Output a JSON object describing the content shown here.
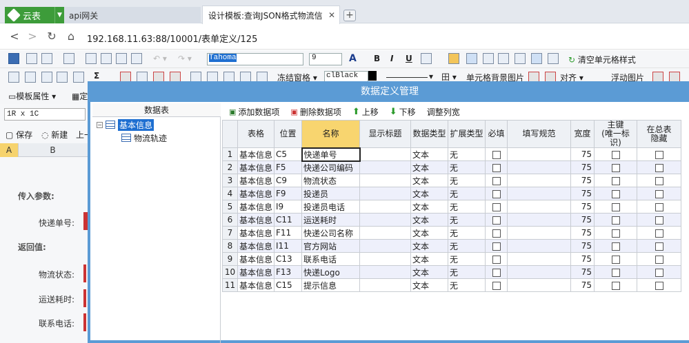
{
  "browser": {
    "brand": "云表",
    "tabs": [
      {
        "label": "api网关"
      },
      {
        "label": "设计模板:查询JSON格式物流信"
      }
    ],
    "url": "192.168.11.63:88/10001/表单定义/125"
  },
  "toolbar": {
    "font_name": "Tahoma",
    "font_size": "9",
    "clear_style": "清空单元格样式",
    "freeze": "冻结窗格",
    "color_value": "clBlack",
    "cell_bg_image": "单元格背景图片",
    "align": "对齐",
    "float_image": "浮动图片",
    "template_props": "模板属性",
    "template_other": "定",
    "bold": "B",
    "italic": "I",
    "underline": "U",
    "font_color": "A",
    "sum": "Σ"
  },
  "sheet": {
    "name_box": "1R x 1C",
    "save": "保存",
    "new": "新建",
    "prev": "上一",
    "col_a": "A",
    "col_b": "B",
    "input_params": "传入参数:",
    "tracking_no": "快递单号:",
    "return_values": "返回值:",
    "logistics_status": "物流状态:",
    "transit_time": "运送耗时:",
    "contact_phone": "联系电话:"
  },
  "dialog": {
    "title": "数据定义管理",
    "tree_header": "数据表",
    "tree_root": "基本信息",
    "tree_child": "物流轨迹",
    "buttons": {
      "add": "添加数据项",
      "delete": "删除数据项",
      "up": "上移",
      "down": "下移",
      "adjust": "调整列宽"
    },
    "columns": [
      "表格",
      "位置",
      "名称",
      "显示标题",
      "数据类型",
      "扩展类型",
      "必填",
      "填写规范",
      "宽度",
      "主键\n(唯一标识)",
      "在总表\n隐藏"
    ],
    "rows": [
      {
        "n": "1",
        "table": "基本信息",
        "pos": "C5",
        "name": "快递单号",
        "title": "",
        "dtype": "文本",
        "ext": "无",
        "width": "75"
      },
      {
        "n": "2",
        "table": "基本信息",
        "pos": "F5",
        "name": "快递公司编码",
        "title": "",
        "dtype": "文本",
        "ext": "无",
        "width": "75"
      },
      {
        "n": "3",
        "table": "基本信息",
        "pos": "C9",
        "name": "物流状态",
        "title": "",
        "dtype": "文本",
        "ext": "无",
        "width": "75"
      },
      {
        "n": "4",
        "table": "基本信息",
        "pos": "F9",
        "name": "投递员",
        "title": "",
        "dtype": "文本",
        "ext": "无",
        "width": "75"
      },
      {
        "n": "5",
        "table": "基本信息",
        "pos": "I9",
        "name": "投递员电话",
        "title": "",
        "dtype": "文本",
        "ext": "无",
        "width": "75"
      },
      {
        "n": "6",
        "table": "基本信息",
        "pos": "C11",
        "name": "运送耗时",
        "title": "",
        "dtype": "文本",
        "ext": "无",
        "width": "75"
      },
      {
        "n": "7",
        "table": "基本信息",
        "pos": "F11",
        "name": "快递公司名称",
        "title": "",
        "dtype": "文本",
        "ext": "无",
        "width": "75"
      },
      {
        "n": "8",
        "table": "基本信息",
        "pos": "I11",
        "name": "官方网站",
        "title": "",
        "dtype": "文本",
        "ext": "无",
        "width": "75"
      },
      {
        "n": "9",
        "table": "基本信息",
        "pos": "C13",
        "name": "联系电话",
        "title": "",
        "dtype": "文本",
        "ext": "无",
        "width": "75"
      },
      {
        "n": "10",
        "table": "基本信息",
        "pos": "F13",
        "name": "快递Logo",
        "title": "",
        "dtype": "文本",
        "ext": "无",
        "width": "75"
      },
      {
        "n": "11",
        "table": "基本信息",
        "pos": "C15",
        "name": "提示信息",
        "title": "",
        "dtype": "文本",
        "ext": "无",
        "width": "75"
      }
    ]
  }
}
